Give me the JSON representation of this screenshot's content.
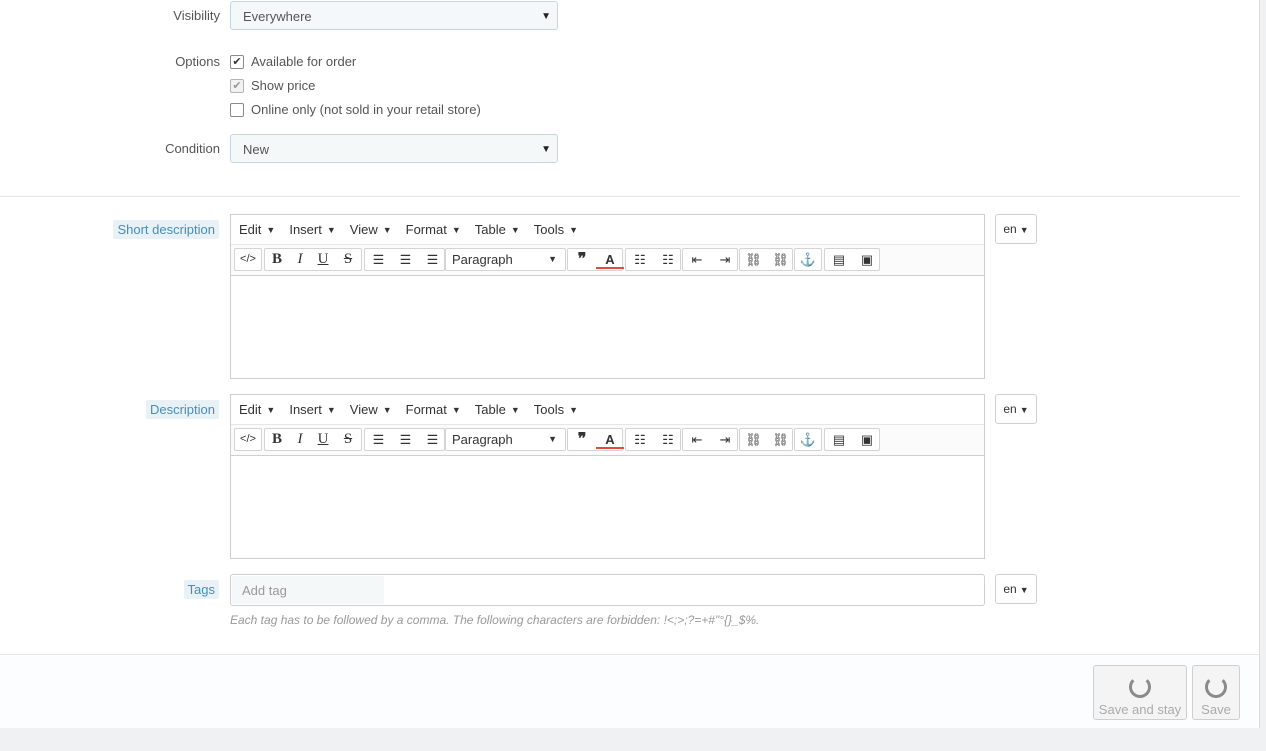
{
  "visibility": {
    "label": "Visibility",
    "value": "Everywhere"
  },
  "options": {
    "label": "Options",
    "items": [
      {
        "label": "Available for order",
        "checked": true,
        "disabled": false
      },
      {
        "label": "Show price",
        "checked": true,
        "disabled": true
      },
      {
        "label": "Online only (not sold in your retail store)",
        "checked": false,
        "disabled": false
      }
    ]
  },
  "condition": {
    "label": "Condition",
    "value": "New"
  },
  "editor_menu": [
    "Edit",
    "Insert",
    "View",
    "Format",
    "Table",
    "Tools"
  ],
  "editor_block_format": "Paragraph",
  "short_description": {
    "label": "Short description",
    "lang": "en"
  },
  "description": {
    "label": "Description",
    "lang": "en"
  },
  "tags": {
    "label": "Tags",
    "placeholder": "Add tag",
    "lang": "en",
    "hint": "Each tag has to be followed by a comma. The following characters are forbidden: !<;>;?=+#\"°{}_$%."
  },
  "footer": {
    "save_and_stay": "Save and stay",
    "save": "Save"
  },
  "icons": {
    "source_code": "code-icon",
    "bold": "bold-icon",
    "italic": "italic-icon",
    "underline": "underline-icon",
    "strike": "strikethrough-icon",
    "align_left": "align-left-icon",
    "align_center": "align-center-icon",
    "align_right": "align-right-icon",
    "blockquote": "blockquote-icon",
    "text_color": "text-color-icon",
    "bullet_list": "bullet-list-icon",
    "numbered_list": "numbered-list-icon",
    "outdent": "outdent-icon",
    "indent": "indent-icon",
    "link": "link-icon",
    "unlink": "unlink-icon",
    "anchor": "anchor-icon",
    "media": "media-icon",
    "image": "image-icon"
  }
}
